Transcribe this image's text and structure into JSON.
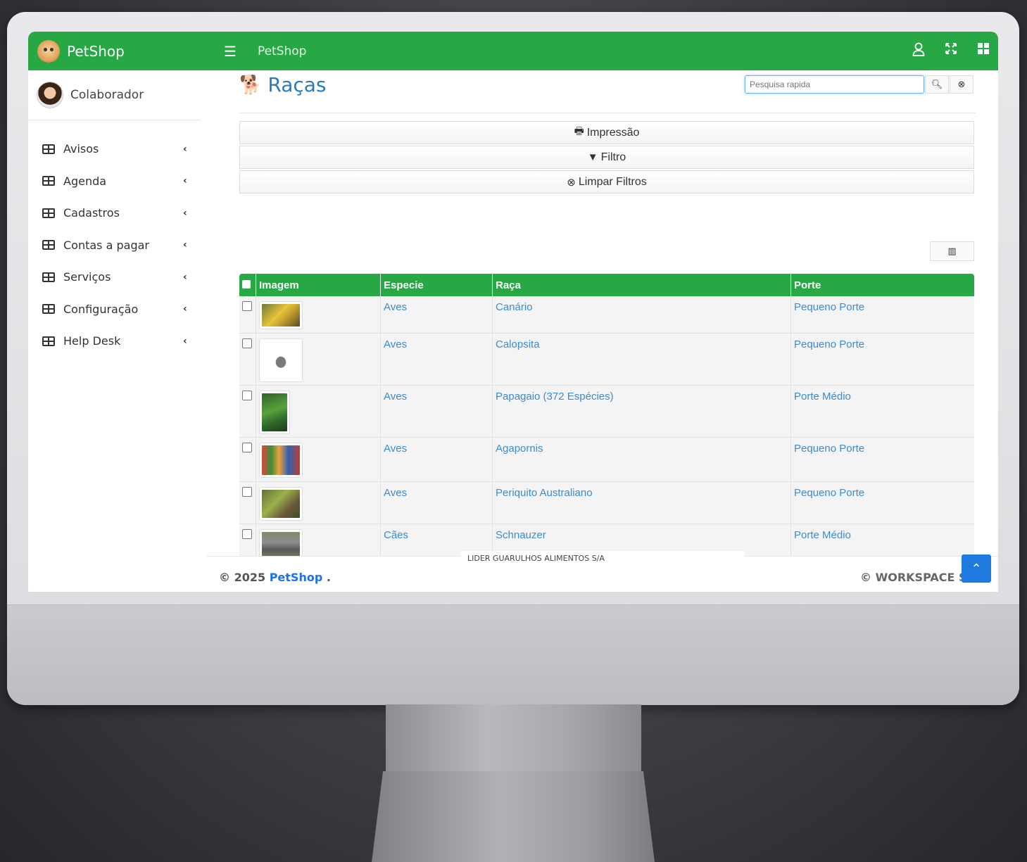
{
  "brand": {
    "name": "PetShop"
  },
  "user": {
    "name": "Colaborador"
  },
  "sidebar": {
    "items": [
      {
        "label": "Avisos"
      },
      {
        "label": "Agenda"
      },
      {
        "label": "Cadastros"
      },
      {
        "label": "Contas a pagar"
      },
      {
        "label": "Serviços"
      },
      {
        "label": "Configuração"
      },
      {
        "label": "Help Desk"
      }
    ]
  },
  "topbar": {
    "title": "PetShop"
  },
  "page": {
    "title": "Raças"
  },
  "search": {
    "placeholder": "Pesquisa rapida"
  },
  "actions": {
    "print_label": "Impressão",
    "filter_label": "Filtro",
    "clear_label": "Limpar Filtros"
  },
  "table": {
    "columns": [
      "Imagem",
      "Especie",
      "Raça",
      "Porte"
    ],
    "rows": [
      {
        "especie": "Aves",
        "raca": "Canário",
        "porte": "Pequeno Porte",
        "image": "canario"
      },
      {
        "especie": "Aves",
        "raca": "Calopsita",
        "porte": "Pequeno Porte",
        "image": "calopsita"
      },
      {
        "especie": "Aves",
        "raca": "Papagaio (372 Espécies)",
        "porte": "Porte Médio",
        "image": "papagaio"
      },
      {
        "especie": "Aves",
        "raca": "Agapornis",
        "porte": "Pequeno Porte",
        "image": "agapornis"
      },
      {
        "especie": "Aves",
        "raca": "Periquito Australiano",
        "porte": "Pequeno Porte",
        "image": "periquito"
      },
      {
        "especie": "Cães",
        "raca": "Schnauzer",
        "porte": "Porte Médio",
        "image": "schnauzer"
      }
    ]
  },
  "footer": {
    "copyright_prefix": "© 2025",
    "copyright_brand": "PetShop",
    "copyright_suffix": ".",
    "company": "LIDER GUARULHOS ALIMENTOS S/A",
    "workspace": "© WORKSPACE Se"
  },
  "colors": {
    "primary": "#28a745",
    "link": "#3a8bd1",
    "title": "#2a7bbd",
    "accent": "#1f7ae0"
  }
}
